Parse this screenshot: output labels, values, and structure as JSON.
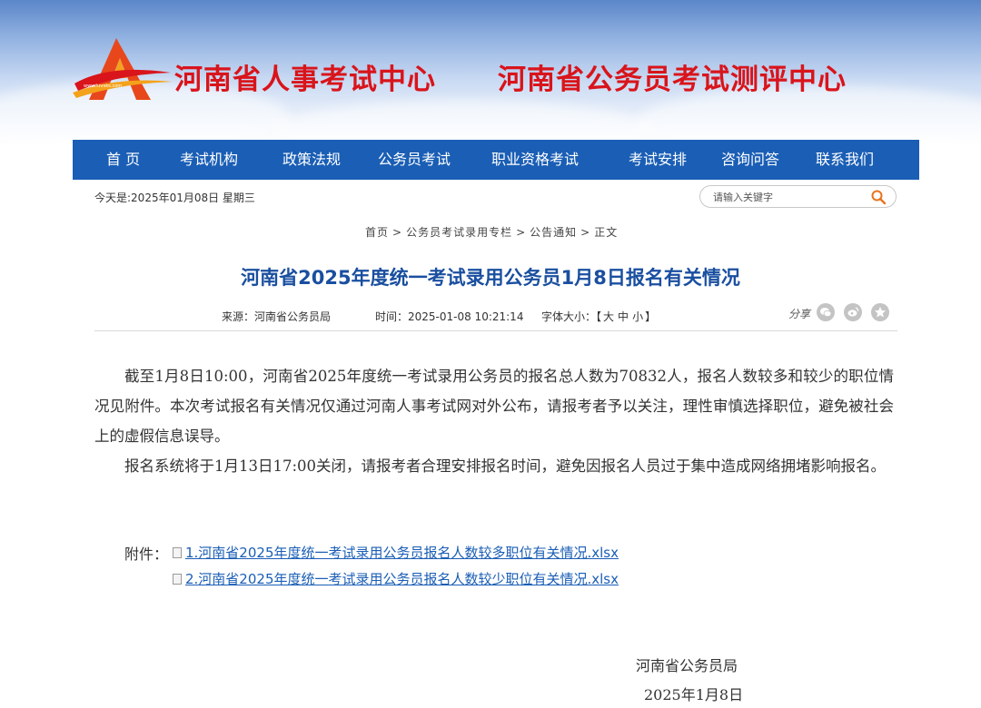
{
  "header": {
    "title_left": "河南省人事考试中心",
    "title_right": "河南省公务员考试测评中心",
    "brand_color": "#d9141b"
  },
  "nav": {
    "items": [
      "首 页",
      "考试机构",
      "政策法规",
      "公务员考试",
      "职业资格考试",
      "考试安排",
      "咨询问答",
      "联系我们"
    ],
    "background": "#1a5eb5"
  },
  "toolbar": {
    "date": "今天是:2025年01月08日 星期三",
    "search_placeholder": "请输入关键字"
  },
  "breadcrumb": [
    "首页",
    "公务员考试录用专栏",
    "公告通知",
    "正文"
  ],
  "article": {
    "title": "河南省2025年度统一考试录用公务员1月8日报名有关情况",
    "source": "来源：河南省公务员局",
    "time": "时间：2025-01-08 10:21:14",
    "font_size_label": "字体大小：",
    "font_sizes": [
      "大",
      "中",
      "小"
    ],
    "share_label": "分享",
    "paragraphs": [
      "截至1月8日10:00，河南省2025年度统一考试录用公务员的报名总人数为70832人，报名人数较多和较少的职位情况见附件。本次考试报名有关情况仅通过河南人事考试网对外公布，请报考者予以关注，理性审慎选择职位，避免被社会上的虚假信息误导。",
      "报名系统将于1月13日17:00关闭，请报考者合理安排报名时间，避免因报名人员过于集中造成网络拥堵影响报名。"
    ],
    "attachment_label": "附件：",
    "attachments": [
      "1.河南省2025年度统一考试录用公务员报名人数较多职位有关情况.xlsx",
      "2.河南省2025年度统一考试录用公务员报名人数较少职位有关情况.xlsx"
    ],
    "signature": "河南省公务员局",
    "signature_date": "2025年1月8日"
  }
}
